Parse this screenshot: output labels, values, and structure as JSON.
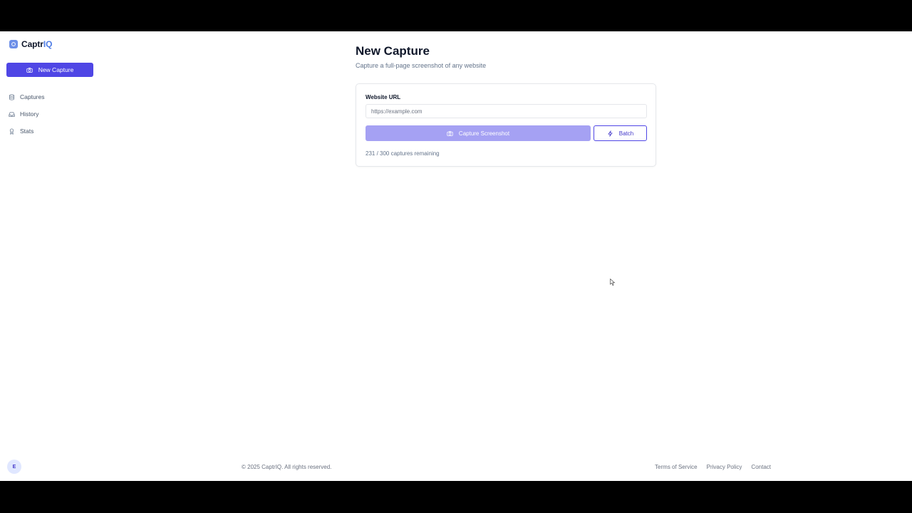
{
  "brand": {
    "name_main": "Captr",
    "name_accent": "IQ"
  },
  "sidebar": {
    "new_capture_label": "New Capture",
    "items": [
      {
        "label": "Captures",
        "icon": "database-icon"
      },
      {
        "label": "History",
        "icon": "inbox-icon"
      },
      {
        "label": "Stats",
        "icon": "award-icon"
      }
    ],
    "avatar_initial": "E"
  },
  "main": {
    "title": "New Capture",
    "subtitle": "Capture a full-page screenshot of any website",
    "form": {
      "url_label": "Website URL",
      "url_value": "",
      "url_placeholder": "https://example.com",
      "capture_button_label": "Capture Screenshot",
      "batch_button_label": "Batch",
      "remaining_text": "231 / 300 captures remaining"
    }
  },
  "footer": {
    "copyright": "© 2025 CaptrIQ. All rights reserved.",
    "links": [
      "Terms of Service",
      "Privacy Policy",
      "Contact"
    ]
  },
  "colors": {
    "primary": "#4f46e5",
    "primary_disabled": "#a5a1f3",
    "brand_accent": "#4f7de6",
    "text_muted": "#64748b"
  }
}
